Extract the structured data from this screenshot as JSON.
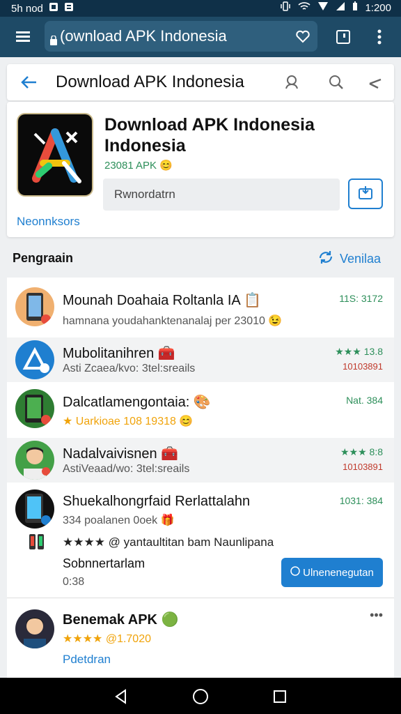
{
  "statusbar": {
    "time_left": "5h nod",
    "time_right": "1:200"
  },
  "browser": {
    "url": "(ownload APK Indonesia"
  },
  "pagebar": {
    "title": "Download APK Indonesia"
  },
  "app": {
    "title": "Download APK Indonesia Indonesia",
    "size": "23081 APK",
    "size_emoji": "😊",
    "input_value": "Rwnordatrn",
    "link": "Neonnksors"
  },
  "section": {
    "heading": "Pengraain",
    "link_label": "Venilaa"
  },
  "rows": [
    {
      "title": "Mounah Doahaia Roltanla IA",
      "title_emoji": "📋",
      "sub": "hamnana youdahanktenanalaj per 23010",
      "sub_emoji": "😉",
      "meta": "11S: 3172",
      "meta2": ""
    },
    {
      "title": "Mubolitanihren",
      "title_emoji": "🧰",
      "sub": "Asti Zcaea/kvo: 3tel:sreails",
      "sub_emoji": "",
      "meta": "★★★ 13.8",
      "meta2": "10103891"
    },
    {
      "title": "Dalcatlamengontaia:",
      "title_emoji": "🎨",
      "sub": "★ Uarkioae 108 19318",
      "sub_emoji": "😊",
      "meta": "Nat. 384",
      "meta2": ""
    },
    {
      "title": "Nadalvaivisnen",
      "title_emoji": "🧰",
      "sub": "AstiVeaad/wo: 3tel:sreails",
      "sub_emoji": "",
      "meta": "★★★ 8:8",
      "meta2": "10103891"
    },
    {
      "title": "Shuekalhongrfaid Rerlattalahn",
      "title_emoji": "",
      "sub": "334 poalanen 0oek",
      "sub_emoji": "🎁",
      "meta": "1031: 384",
      "meta2": "",
      "line3": "★★★★ @ yantaultitan bam Naunlipana",
      "line4": "Sobnnertarlam",
      "line5": "0:38",
      "button": "Ulnenenegutan"
    },
    {
      "title": "Benemak APK",
      "title_emoji": "🟢",
      "sub": "★★★★ @1.7020",
      "sub_emoji": "",
      "meta": "•••",
      "meta2": "",
      "line3": "Pdetdran"
    }
  ],
  "icons": {
    "menu": "menu-icon",
    "lock": "lock-icon",
    "heart": "heart-icon",
    "tabs": "tabs-icon",
    "more": "more-vert-icon",
    "back": "back-arrow-icon",
    "search1": "search-icon",
    "search2": "search-icon",
    "share": "share-icon",
    "download": "download-icon",
    "refresh": "refresh-icon",
    "nav_back": "nav-back-icon",
    "nav_home": "nav-home-icon",
    "nav_recent": "nav-recent-icon"
  },
  "colors": {
    "accent": "#1f7fd0",
    "header": "#1e4a66",
    "status_green": "#2d8f5a",
    "status_red": "#c0392b"
  }
}
